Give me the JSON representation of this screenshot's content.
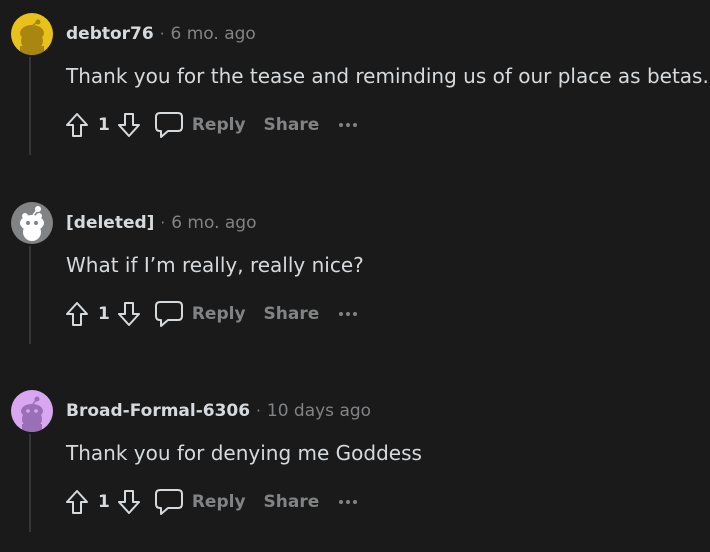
{
  "comments": [
    {
      "username": "debtor76",
      "separator": "·",
      "time": "6 mo. ago",
      "body": "Thank you for the tease and reminding us of our place as betas.",
      "score": "1",
      "reply_label": "Reply",
      "share_label": "Share",
      "avatar_color": "#e8c21a"
    },
    {
      "username": "[deleted]",
      "separator": "·",
      "time": "6 mo. ago",
      "body": "What if I’m really, really nice?",
      "score": "1",
      "reply_label": "Reply",
      "share_label": "Share",
      "avatar_color": "#818384"
    },
    {
      "username": "Broad-Formal-6306",
      "separator": "·",
      "time": "10 days ago",
      "body": "Thank you for denying me Goddess",
      "score": "1",
      "reply_label": "Reply",
      "share_label": "Share",
      "avatar_color": "#d9a7f2"
    }
  ],
  "icons": {
    "upvote": "arrow-up-icon",
    "downvote": "arrow-down-icon",
    "reply": "speech-bubble-icon",
    "more": "ellipsis-icon"
  },
  "colors": {
    "background": "#1a1a1b",
    "text": "#d7dadc",
    "muted": "#818384",
    "thread_line": "#343536"
  }
}
